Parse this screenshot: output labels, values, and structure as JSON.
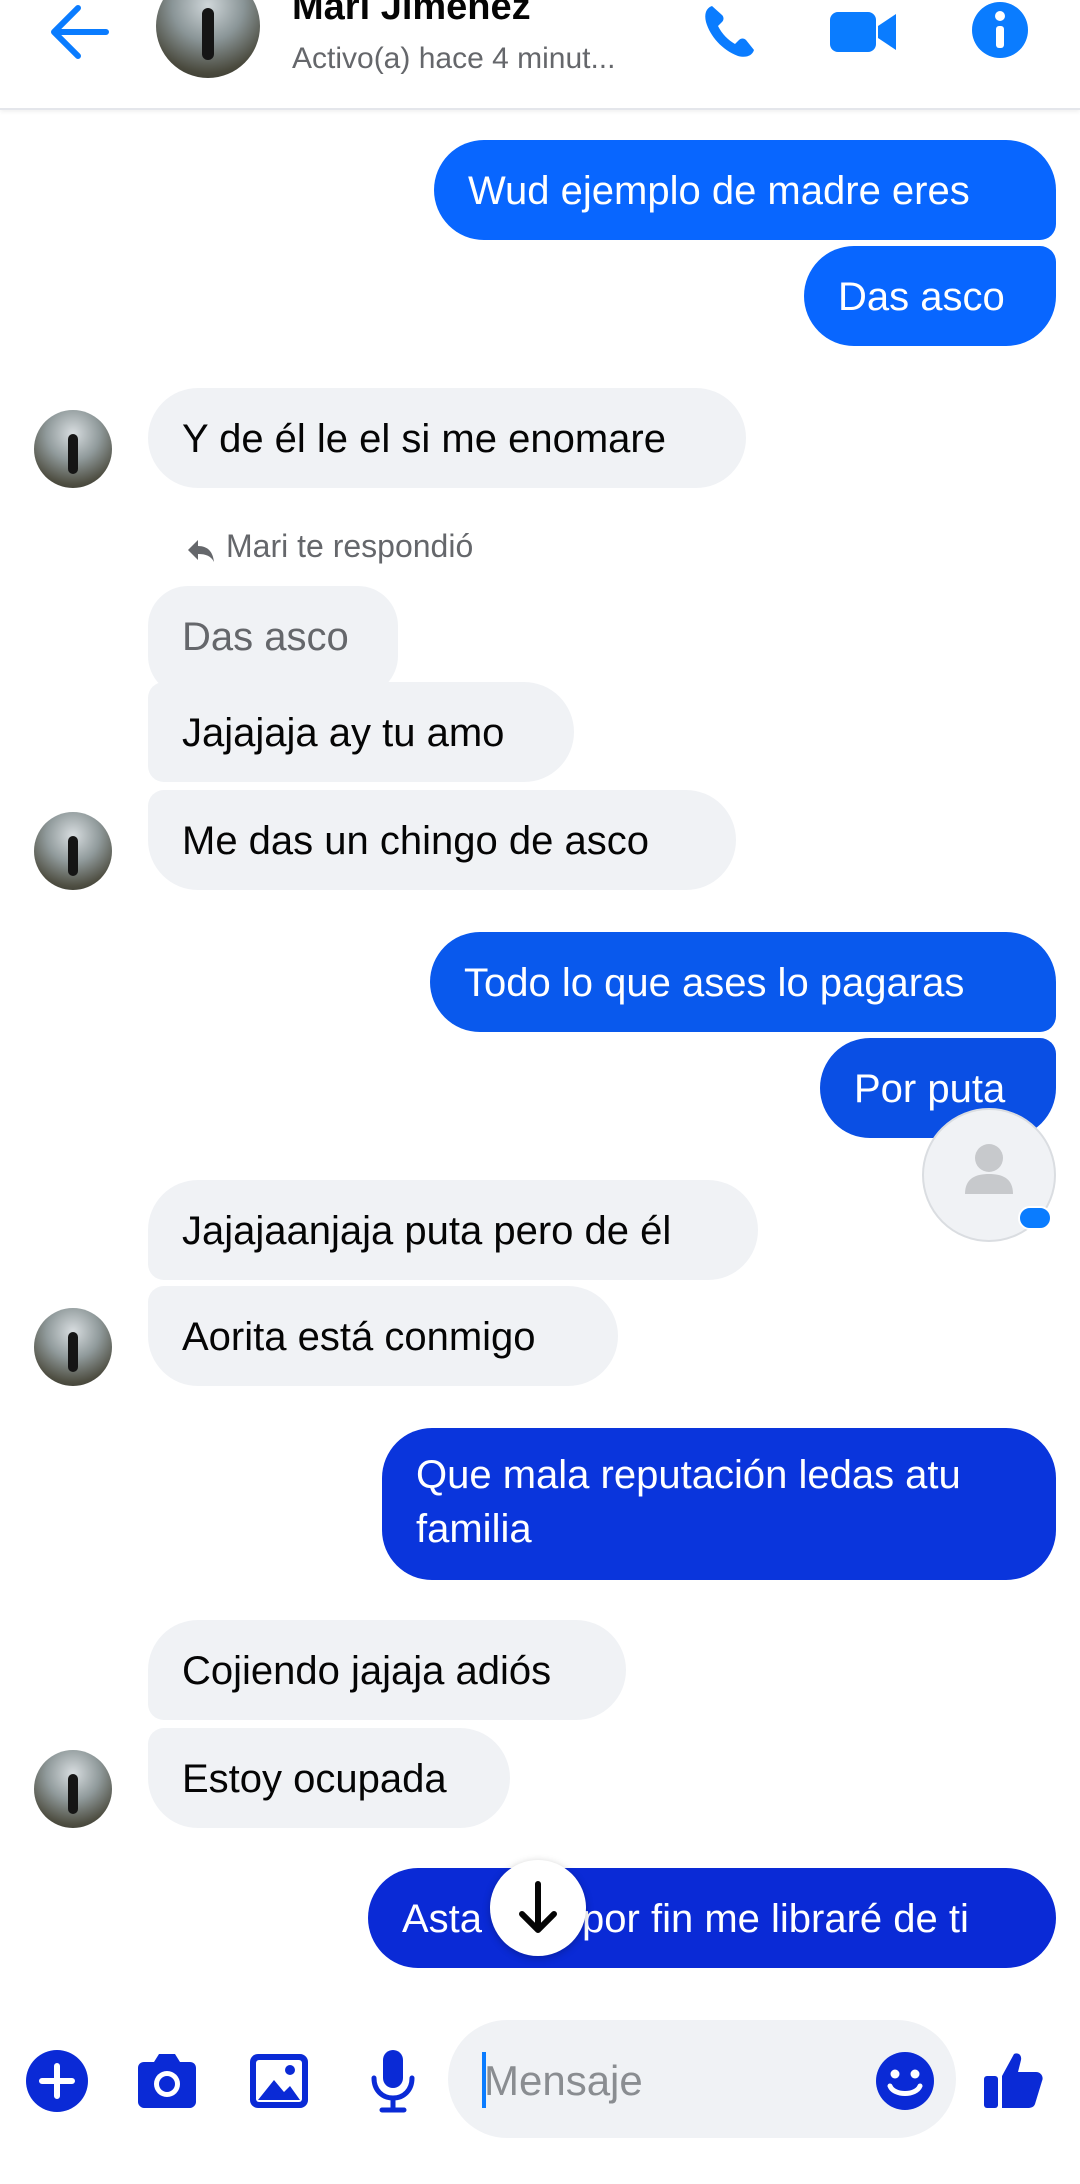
{
  "header": {
    "name": "Mari Jiménez",
    "status": "Activo(a) hace 4 minut..."
  },
  "colors": {
    "accent": "#0a7cff",
    "incoming_bubble": "#f0f2f5",
    "outgoing_light": "#0866ff",
    "outgoing_dark": "#0a2ad6"
  },
  "messages": [
    {
      "from": "me",
      "text": "Wud ejemplo de madre eres"
    },
    {
      "from": "me",
      "text": "Das asco"
    },
    {
      "from": "them",
      "text": "Y de él le el si me enomare"
    },
    {
      "from": "them",
      "reply_to": "Das asco",
      "text": "Jajajaja ay tu amo"
    },
    {
      "from": "them",
      "text": "Me das un chingo de asco"
    },
    {
      "from": "me",
      "text": "Todo lo que ases lo pagaras"
    },
    {
      "from": "me",
      "text": "Por puta"
    },
    {
      "from": "them",
      "text": "Jajajaanjaja puta pero de él"
    },
    {
      "from": "them",
      "text": "Aorita está conmigo"
    },
    {
      "from": "me",
      "text": "Que mala reputación ledas atu familia"
    },
    {
      "from": "them",
      "text": "Cojiendo jajaja adiós"
    },
    {
      "from": "them",
      "text": "Estoy ocupada"
    },
    {
      "from": "me",
      "text": "Asta por fin me libraré de ti"
    }
  ],
  "reply_label": "Mari te respondió",
  "composer": {
    "placeholder": "Mensaje"
  },
  "icons": {
    "back": "arrow-left-icon",
    "call": "phone-icon",
    "video": "video-camera-icon",
    "info": "info-icon",
    "add": "plus-circle-icon",
    "camera": "camera-icon",
    "gallery": "image-icon",
    "mic": "microphone-icon",
    "emoji": "emoji-icon",
    "like": "thumbs-up-icon",
    "scroll": "arrow-down-icon"
  }
}
